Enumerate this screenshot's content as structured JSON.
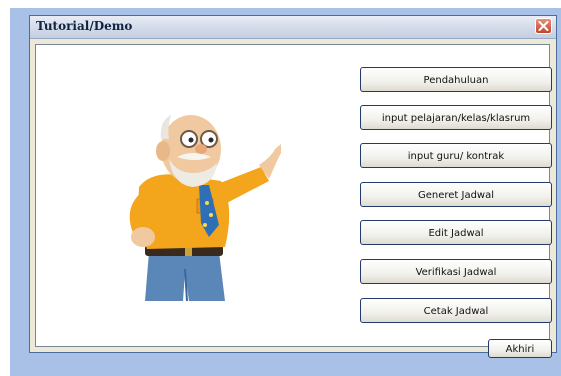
{
  "window": {
    "title": "Tutorial/Demo"
  },
  "menu": {
    "items": [
      {
        "label": "Pendahuluan"
      },
      {
        "label": "input pelajaran/kelas/klasrum"
      },
      {
        "label": "input guru/ kontrak"
      },
      {
        "label": "Generet Jadwal"
      },
      {
        "label": "Edit Jadwal"
      },
      {
        "label": "Verifikasi Jadwal"
      },
      {
        "label": "Cetak Jadwal"
      }
    ]
  },
  "footer": {
    "exit_label": "Akhiri"
  },
  "icons": {
    "close": "close-icon",
    "mascot": "old-man-mascot"
  },
  "colors": {
    "close_button": "#c5432a",
    "title_bar": "#d3dbea",
    "frame": "#a9c1e6"
  }
}
